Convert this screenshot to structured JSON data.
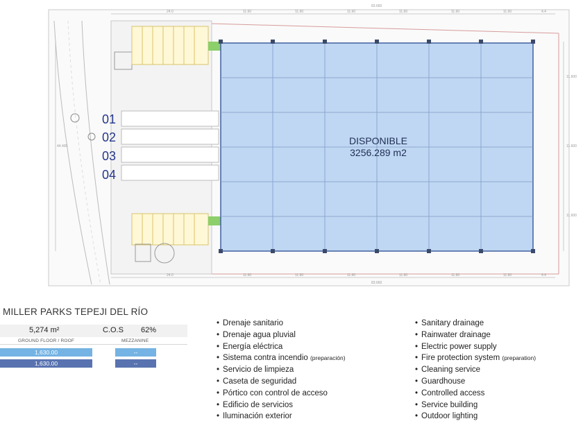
{
  "plan": {
    "available_label": "DISPONIBLE",
    "available_area": "3256.289 m2",
    "docks": [
      "01",
      "02",
      "03",
      "04"
    ],
    "top_dims": [
      "24.0",
      "11.60",
      "11.60",
      "11.60",
      "11.60",
      "11.60",
      "11.60",
      "4.4"
    ],
    "top_total": "83.660",
    "bottom_dims": [
      "24.0",
      "11.60",
      "11.60",
      "11.60",
      "11.60",
      "11.60",
      "11.60",
      "4.4"
    ],
    "bottom_total": "83.660",
    "side_dims": [
      "11.600",
      "11.600",
      "11.600"
    ],
    "side_total": "44.400"
  },
  "info": {
    "title": "MILLER PARKS TEPEJI DEL RÍO",
    "total_area": "5,274 m²",
    "cos_label": "C.O.S",
    "cos_value": "62%",
    "ground_label": "GROUND FLOOR / ROOF",
    "mezzanine_label": "MEZZANINE",
    "ground_values": [
      "1,630.00",
      "1,630.00"
    ],
    "mezzanine_values": [
      "--",
      "--"
    ],
    "colors": {
      "bar_light": "#74b3e3",
      "bar_dark": "#5973b0",
      "available_fill": "#bfd7f2",
      "available_stroke": "#3f5fa0"
    }
  },
  "amenities_es": [
    {
      "text": "Drenaje sanitario"
    },
    {
      "text": "Drenaje agua pluvial"
    },
    {
      "text": "Energía eléctrica"
    },
    {
      "text": "Sistema contra incendio",
      "note": "(preparación)"
    },
    {
      "text": "Servicio de limpieza"
    },
    {
      "text": "Caseta de seguridad"
    },
    {
      "text": "Pórtico con control de acceso"
    },
    {
      "text": "Edificio de servicios"
    },
    {
      "text": "Iluminación exterior"
    }
  ],
  "amenities_en": [
    {
      "text": "Sanitary drainage"
    },
    {
      "text": "Rainwater drainage"
    },
    {
      "text": "Electric power supply"
    },
    {
      "text": "Fire protection system",
      "note": "(preparation)"
    },
    {
      "text": "Cleaning service"
    },
    {
      "text": "Guardhouse"
    },
    {
      "text": "Controlled access"
    },
    {
      "text": "Service building"
    },
    {
      "text": "Outdoor lighting"
    }
  ]
}
